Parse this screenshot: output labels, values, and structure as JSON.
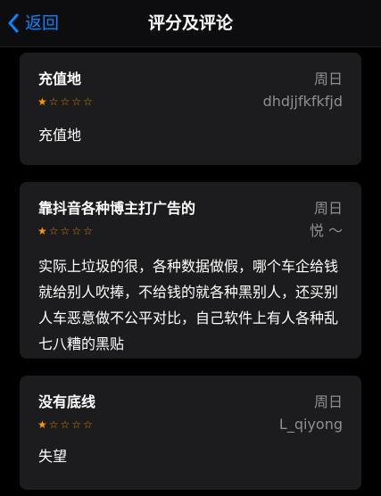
{
  "nav": {
    "back_label": "返回",
    "title": "评分及评论",
    "accent": "#0a84ff"
  },
  "reviews": [
    {
      "title": "充值地",
      "date": "周日",
      "user": "dhdjjfkfkfjd",
      "rating": 1,
      "max_rating": 5,
      "body": "充值地"
    },
    {
      "title": "靠抖音各种博主打广告的",
      "date": "周日",
      "user": "悦 ～",
      "rating": 1,
      "max_rating": 5,
      "body": "实际上垃圾的很，各种数据做假，哪个车企给钱就给别人吹捧，不给钱的就各种黑别人，还买别人车恶意做不公平对比，自己软件上有人各种乱七八糟的黑贴"
    },
    {
      "title": "没有底线",
      "date": "周日",
      "user": "L_qiyong",
      "rating": 1,
      "max_rating": 5,
      "body": "失望"
    }
  ],
  "colors": {
    "star": "#ff9500",
    "card_bg": "#1c1c1e",
    "secondary_text": "#8e8e93"
  }
}
